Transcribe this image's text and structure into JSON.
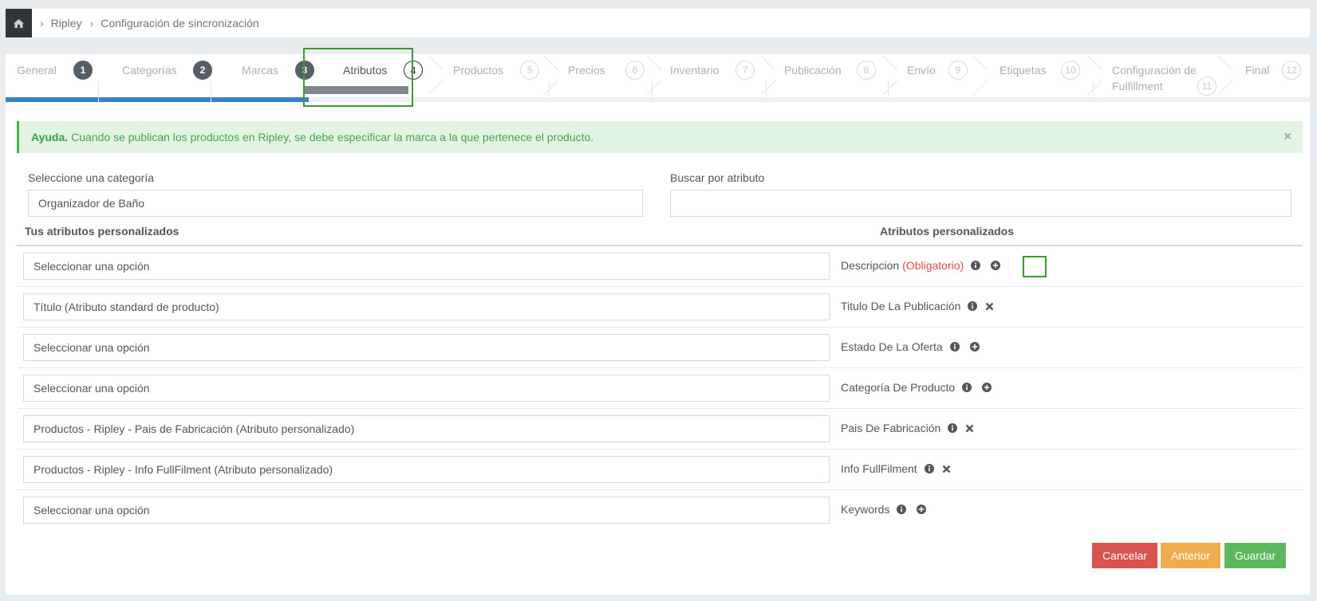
{
  "breadcrumb": {
    "items": [
      "Ripley",
      "Configuración de sincronización"
    ]
  },
  "steps": [
    {
      "label": "General",
      "num": "1",
      "state": "done"
    },
    {
      "label": "Categorías",
      "num": "2",
      "state": "done"
    },
    {
      "label": "Marcas",
      "num": "3",
      "state": "done"
    },
    {
      "label": "Atributos",
      "num": "4",
      "state": "active"
    },
    {
      "label": "Productos",
      "num": "5",
      "state": "todo"
    },
    {
      "label": "Precios",
      "num": "6",
      "state": "todo"
    },
    {
      "label": "Inventario",
      "num": "7",
      "state": "todo"
    },
    {
      "label": "Publicación",
      "num": "8",
      "state": "todo"
    },
    {
      "label": "Envío",
      "num": "9",
      "state": "todo"
    },
    {
      "label": "Etiquetas",
      "num": "10",
      "state": "todo"
    },
    {
      "label": "Configuración de",
      "label2": "Fulfillment",
      "num": "11",
      "state": "todo"
    },
    {
      "label": "Final",
      "num": "12",
      "state": "todo"
    }
  ],
  "alert": {
    "title": "Ayuda.",
    "text": "Cuando se publican los productos en Ripley, se debe especificar la marca a la que pertenece el producto."
  },
  "filters": {
    "category_label": "Seleccione una categoría",
    "category_value": "Organizador de Baño",
    "search_label": "Buscar por atributo",
    "search_value": ""
  },
  "table": {
    "left_header": "Tus atributos personalizados",
    "right_header": "Atributos personalizados",
    "rows": [
      {
        "select": "Seleccionar una opción",
        "name": "Descripcion",
        "required": "(Obligatorio)",
        "action": "add"
      },
      {
        "select": "Título (Atributo standard de producto)",
        "name": "Titulo De La Publicación",
        "required": "",
        "action": "remove"
      },
      {
        "select": "Seleccionar una opción",
        "name": "Estado De La Oferta",
        "required": "",
        "action": "add"
      },
      {
        "select": "Seleccionar una opción",
        "name": "Categoría De Producto",
        "required": "",
        "action": "add"
      },
      {
        "select": "Productos - Ripley - Pais de Fabricación (Atributo personalizado)",
        "name": "Pais De Fabricación",
        "required": "",
        "action": "remove"
      },
      {
        "select": "Productos - Ripley - Info FullFilment (Atributo personalizado)",
        "name": "Info FullFilment",
        "required": "",
        "action": "remove"
      },
      {
        "select": "Seleccionar una opción",
        "name": "Keywords",
        "required": "",
        "action": "add"
      }
    ]
  },
  "buttons": {
    "cancel": "Cancelar",
    "previous": "Anterior",
    "save": "Guardar"
  },
  "colors": {
    "cancel": "#d9534f",
    "previous": "#f0ad4e",
    "save": "#5cb85c",
    "progress": "#3b80c6",
    "highlight": "#3d9a2e"
  }
}
